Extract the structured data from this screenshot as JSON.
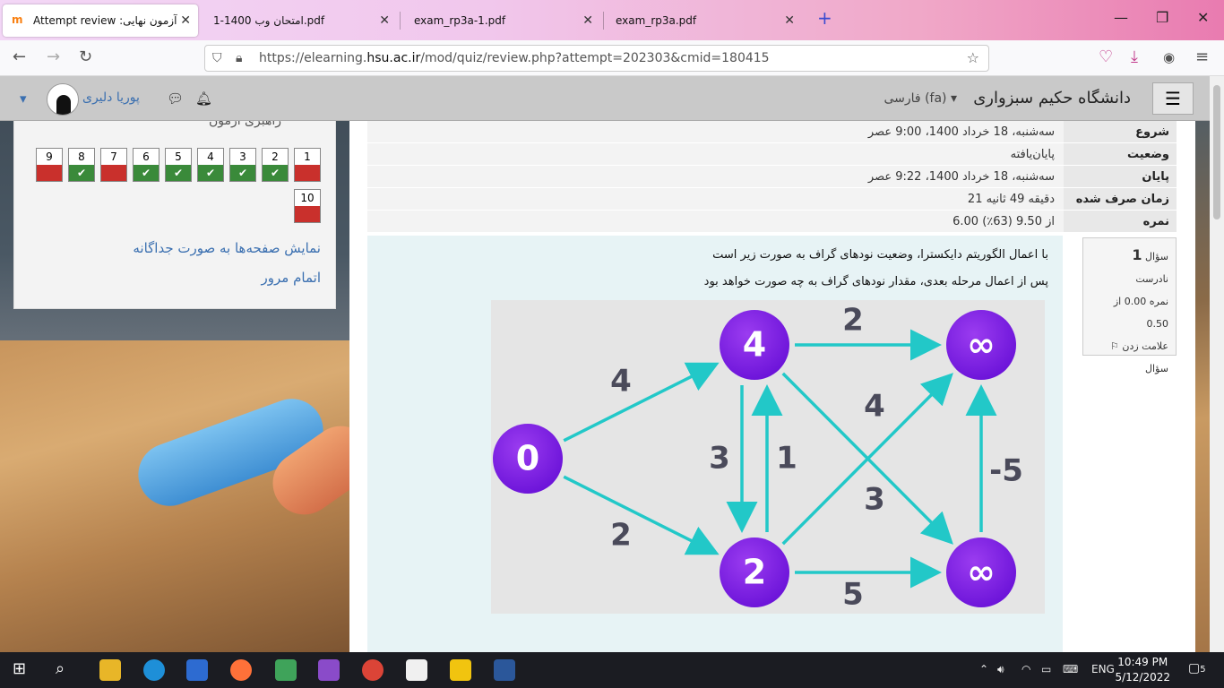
{
  "tabs": [
    {
      "label": "Attempt review :آزمون نهایی",
      "active": true
    },
    {
      "label": "امتحان وب 1400-1.pdf"
    },
    {
      "label": "exam_rp3a-1.pdf"
    },
    {
      "label": "exam_rp3a.pdf"
    }
  ],
  "url": {
    "prefix": "https://elearning.",
    "host": "hsu.ac.ir",
    "path": "/mod/quiz/review.php?attempt=202303&cmid=180415"
  },
  "header": {
    "brand": "دانشگاه حکیم سبزواری",
    "lang": "فارسی (fa)",
    "user": "پوریا دلیری"
  },
  "sidebar": {
    "title": "راهبری آزمون",
    "questions": [
      {
        "n": "1",
        "state": "bad"
      },
      {
        "n": "2",
        "state": "ok"
      },
      {
        "n": "3",
        "state": "ok"
      },
      {
        "n": "4",
        "state": "ok"
      },
      {
        "n": "5",
        "state": "ok"
      },
      {
        "n": "6",
        "state": "ok"
      },
      {
        "n": "7",
        "state": "bad"
      },
      {
        "n": "8",
        "state": "ok"
      },
      {
        "n": "9",
        "state": "bad"
      },
      {
        "n": "10",
        "state": "bad"
      }
    ],
    "link_pages": "نمایش صفحه‌ها به صورت جداگانه",
    "link_finish": "اتمام مرور"
  },
  "summary": [
    {
      "k": "شروع",
      "v": "سه‌شنبه، 18 خرداد 1400، 9:00 عصر"
    },
    {
      "k": "وضعیت",
      "v": "پایان‌یافته"
    },
    {
      "k": "پایان",
      "v": "سه‌شنبه، 18 خرداد 1400، 9:22 عصر"
    },
    {
      "k": "زمان صرف شده",
      "v": "21 دقیقه 49 ثانیه"
    },
    {
      "k": "نمره",
      "v": "6.00 از 9.50 (63٪)"
    }
  ],
  "qinfo": {
    "label": "سؤال",
    "num": "1",
    "state": "نادرست",
    "grade": "نمره 0.00 از 0.50",
    "flag": "علامت زدن سؤال"
  },
  "question": {
    "line1": "با اعمال الگوریتم دایکسترا، وضعیت نودهای گراف به صورت زیر است",
    "line2": "پس از اعمال مرحله بعدی، مقدار نودهای گراف  به چه صورت خواهد بود"
  },
  "graph": {
    "nodes": [
      {
        "id": "A",
        "label": "0"
      },
      {
        "id": "B",
        "label": "4"
      },
      {
        "id": "C",
        "label": "2"
      },
      {
        "id": "D",
        "label": "∞"
      },
      {
        "id": "E",
        "label": "∞"
      }
    ],
    "edges": [
      {
        "from": "A",
        "to": "B",
        "w": "4"
      },
      {
        "from": "A",
        "to": "C",
        "w": "2"
      },
      {
        "from": "B",
        "to": "C",
        "w": "3"
      },
      {
        "from": "C",
        "to": "B",
        "w": "1"
      },
      {
        "from": "B",
        "to": "D",
        "w": "2"
      },
      {
        "from": "B",
        "to": "E",
        "w": "3"
      },
      {
        "from": "C",
        "to": "D",
        "w": "4"
      },
      {
        "from": "C",
        "to": "E",
        "w": "5"
      },
      {
        "from": "E",
        "to": "D",
        "w": "-5"
      }
    ]
  },
  "tray": {
    "lang": "ENG",
    "time": "10:49 PM",
    "date": "5/12/2022",
    "notif": "5"
  }
}
